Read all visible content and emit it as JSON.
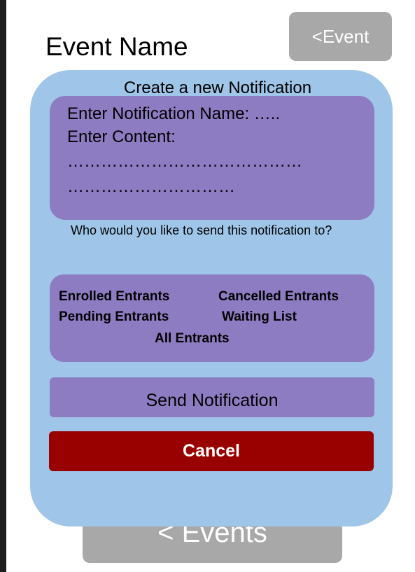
{
  "header": {
    "title": "Event Name",
    "back_event_label": "<Event",
    "back_events_label": "< Events"
  },
  "dialog": {
    "title": "Create a new Notification",
    "name_prompt": "Enter Notification Name: …..",
    "content_prompt": "Enter Content:",
    "content_dots_1": "……………………………………",
    "content_dots_2": "…………………………",
    "question": "Who would you like to send this notification to?",
    "recipients": {
      "enrolled": "Enrolled Entrants",
      "cancelled": "Cancelled Entrants",
      "pending": "Pending Entrants",
      "waiting": "Waiting List",
      "all": "All Entrants"
    },
    "send_label": "Send Notification",
    "cancel_label": "Cancel"
  },
  "colors": {
    "panel": "#9fc5e8",
    "box": "#8e7cc3",
    "cancel": "#990000",
    "nav_button": "#a8a8a8"
  }
}
